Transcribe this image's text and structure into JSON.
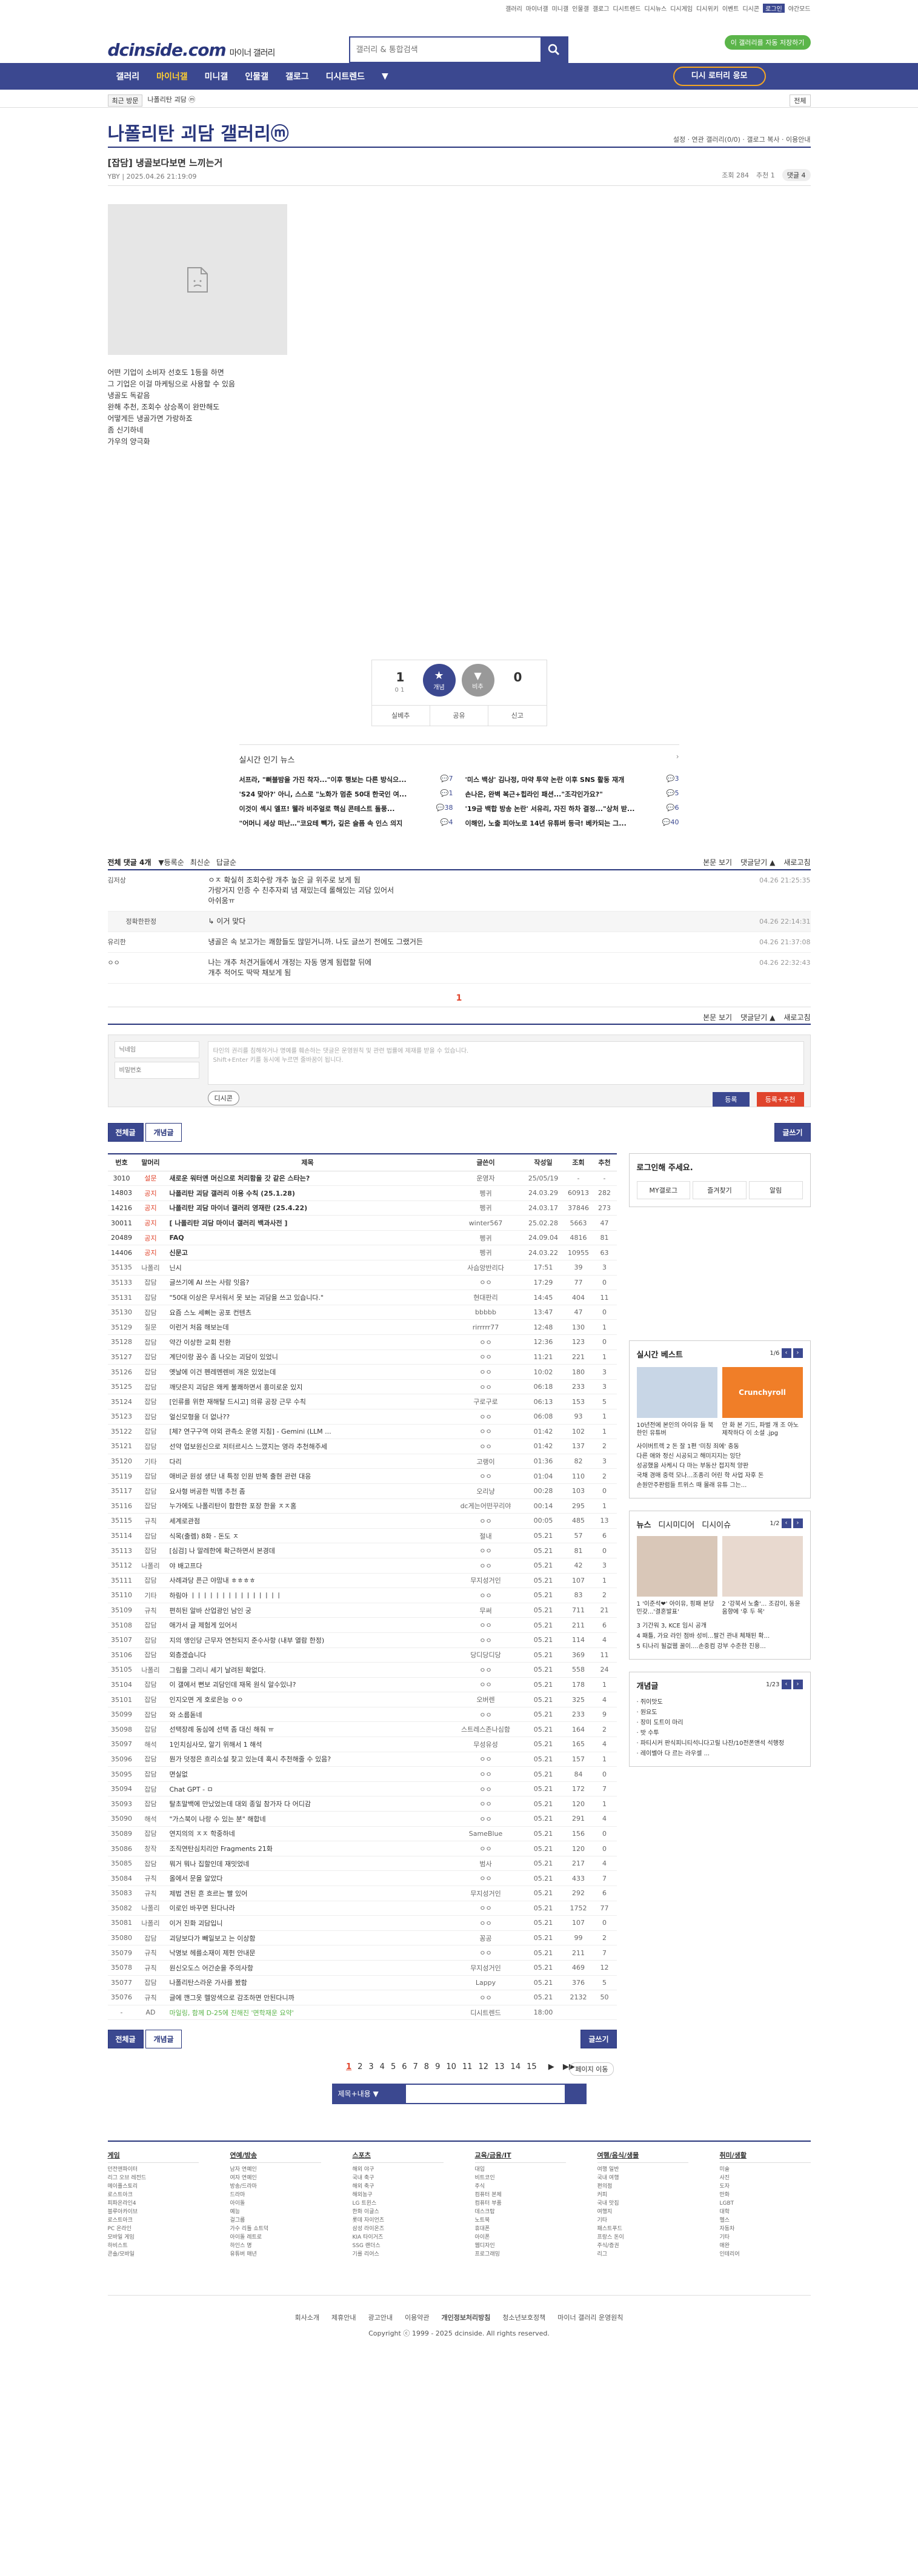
{
  "topbar": {
    "links": [
      "갤러리",
      "마이너갤",
      "미니갤",
      "인물갤",
      "갤로그",
      "디시트렌드",
      "디시뉴스",
      "디시게임",
      "디시위키",
      "이벤트",
      "디시콘",
      "로그인",
      "야간모드"
    ],
    "green": "이 갤러리를 자동 저장하기"
  },
  "header": {
    "logo": "dcinside.com",
    "logo_sub": "마이너 갤러리",
    "search_placeholder": "갤러리 & 통합검색"
  },
  "nav": {
    "items": [
      "갤러리",
      "마이너갤",
      "미니갤",
      "인물갤",
      "갤로그",
      "디시트렌드",
      "▼"
    ],
    "gold": "디시 로터리 응모"
  },
  "sub": {
    "recent": "최근 방문",
    "box": "나폴리탄 괴담 ⓜ",
    "close": "전체"
  },
  "gallery": {
    "title": "나폴리탄 괴담 갤러리ⓜ",
    "right": "설정 · 연관 갤러리(0/0) · 갤로그 복사 · 이용안내"
  },
  "post": {
    "title": "[잡담] 냉골보다보면 느끼는거",
    "author": "YBY",
    "date": "2025.04.26 21:19:09",
    "views": "조회 284",
    "rec": "추천 1",
    "cmt": "댓글 4",
    "body": [
      "어떤 기업이 소비자 선호도 1등을 하면",
      "그 기업은 이걸 마케팅으로 사용할 수 있음",
      "냉골도 독같음",
      "완해 추천, 조회수 상승폭이 완만해도",
      "어떻게든 냉골가면 가랑하죠",
      "좀 신기하네",
      "가우의 양극화"
    ]
  },
  "rec": {
    "up": "1",
    "up_sub": "0 1",
    "up_label": "개념",
    "down": "0",
    "down_label": "비추",
    "b1": "실베추",
    "b2": "공유",
    "b3": "신고"
  },
  "news": {
    "title": "실시간 인기 뉴스",
    "items": [
      {
        "t": "서프라, \"뻐블밤을 가진 착자...\"이후 행보는 다른 방식으...",
        "n": "7"
      },
      {
        "t": "'미스 백상' 김나정, 마약 투약 논란 이후 SNS 활동 재개",
        "n": "3"
      },
      {
        "t": "'S24 맞아?' 아니, 스스로 \"노화가 멈춘 50대 한국인 여...",
        "n": "1"
      },
      {
        "t": "손나은, 완벽 복근+힙라인 패션...\"조각인가요?\"",
        "n": "5"
      },
      {
        "t": "이것이 섹시 엘프! 웰라 비주얼로 핵심 콘테스트 돌풍...",
        "n": "38"
      },
      {
        "t": "'19금 백합 방송 논란' 서유리, 자진 하차 결정...\"상처 받...",
        "n": "6"
      },
      {
        "t": "\"어머니 세상 떠난…\"코요테 빽가, 깊은 슬픔 속 인스 의지",
        "n": "4"
      },
      {
        "t": "이해인, 노출 피아노로 14년 유튜버 등극! 베카되는 그...",
        "n": "40"
      }
    ]
  },
  "comments": {
    "header": "전체 댓글 4개",
    "sort": [
      "▼등록순",
      "최신순",
      "답글순"
    ],
    "right": [
      "본문 보기",
      "댓글닫기 ▲",
      "새로고침"
    ],
    "items": [
      {
        "nick": "김저상",
        "text": "ㅇㅈ 확실히 조회수랑 개추 높은 글 위주로 보게 됨\n가랑거지 인증 수 친추자뢰 냄 재밌는데 롤해있는 괴담 있어서\n아쉬움ㅠ",
        "date": "04.26 21:25:35"
      },
      {
        "nick": "정확한판정",
        "text": "↳ 이거 맞다",
        "date": "04.26 22:14:31",
        "reply": true
      },
      {
        "nick": "유리한",
        "text": "냉골은 속 보고가는 쾌함들도 많믿거니까. 나도 글쓰기 전에도 그랬거든",
        "date": "04.26 21:37:08"
      },
      {
        "nick": "ㅇㅇ",
        "text": "나는 개추 처견거들에서 개정는 자동 명계 됨렵할 뒤에\n개추 적어도 딱딱 채보게 됨",
        "date": "04.26 22:32:43"
      }
    ],
    "page": "1"
  },
  "write": {
    "nick_ph": "닉네임",
    "pw_ph": "비밀번호",
    "ta": "타인의 권리를 침해하거나 명예를 훼손하는 댓글은 운영원칙 및 관련 법률에 제재를 받을 수 있습니다.\nShift+Enter 키를 동시에 누르면 줄바꿈이 됩니다.",
    "dc": "디시콘",
    "submit": "등록",
    "submit2": "등록+추천"
  },
  "listbtns": {
    "all": "전체글",
    "concept": "개념글",
    "write": "글쓰기"
  },
  "list": {
    "headers": [
      "번호",
      "말머리",
      "제목",
      "글쓴이",
      "작성일",
      "조회",
      "추천"
    ],
    "rows": [
      [
        "3010",
        "설문",
        "새로운 워터앤 머신으로 처리함을 갓 같은 스타는?",
        "운영자",
        "25/05/19",
        "-",
        "-",
        true
      ],
      [
        "14803",
        "공지",
        "나폴리탄 괴담 갤러리 이용 수칙 (25.1.28)",
        "펭귀",
        "24.03.29",
        "60913",
        "282",
        true
      ],
      [
        "14216",
        "공지",
        "나폴리탄 괴담 마이너 갤러리 영재란 (25.4.22)",
        "펭귀",
        "24.03.17",
        "37846",
        "273",
        true
      ],
      [
        "30011",
        "공지",
        "[ 나폴리탄 괴담 마이너 갤러리 백과사전 ]",
        "winter567",
        "25.02.28",
        "5663",
        "47",
        true
      ],
      [
        "20489",
        "공지",
        "FAQ",
        "펭귀",
        "24.09.04",
        "4816",
        "81",
        true
      ],
      [
        "14406",
        "공지",
        "신문고",
        "펭귀",
        "24.03.22",
        "10955",
        "63",
        true
      ],
      [
        "35135",
        "나폴리",
        "닌시",
        "사슴앙반리다",
        "17:51",
        "39",
        "3",
        false
      ],
      [
        "35133",
        "잡담",
        "글쓰기에 AI 쓰는 사람 잇음?",
        "ㅇㅇ",
        "17:29",
        "77",
        "0",
        false
      ],
      [
        "35131",
        "잡담",
        "\"50대 이상은 무서워서 못 보는 괴담을 쓰고 있습니다.\"",
        "현대판리",
        "14:45",
        "404",
        "11",
        false
      ],
      [
        "35130",
        "잡담",
        "요즘 스노 세뻐는 공포 컨텐츠",
        "bbbbb",
        "13:47",
        "47",
        "0",
        false
      ],
      [
        "35129",
        "질문",
        "이런거 처음 해보는데",
        "rirrrrr77",
        "12:48",
        "130",
        "1",
        false
      ],
      [
        "35128",
        "잡담",
        "약간 이상한 교회 전환",
        "ㅇㅇ",
        "12:36",
        "123",
        "0",
        false
      ],
      [
        "35127",
        "잡담",
        "계단이랑 꿈수 좀 나오는 괴담이 있었니",
        "ㅇㅇ",
        "11:21",
        "221",
        "1",
        false
      ],
      [
        "35126",
        "잡담",
        "옛날에 이건 펜레멘렌비 개온 있었는데",
        "ㅇㅇ",
        "10:02",
        "180",
        "3",
        false
      ],
      [
        "35125",
        "잡담",
        "깨닷은지 괴담은 왜케 불쾌하면서 흥미로운 있지",
        "ㅇㅇ",
        "06:18",
        "233",
        "3",
        false
      ],
      [
        "35124",
        "잡담",
        "[인류를 위한 재해탈 드시고] 의류 공장 근무 수칙",
        "구로구로",
        "06:13",
        "153",
        "5",
        false
      ],
      [
        "35123",
        "잡담",
        "얼신모형을 더 없나??",
        "ㅇㅇ",
        "06:08",
        "93",
        "1",
        false
      ],
      [
        "35122",
        "잡담",
        "[체? 연구구역 야외 관측소 운영 지침] - Gemini (LLM ...",
        "ㅇㅇ",
        "01:42",
        "102",
        "1",
        false
      ],
      [
        "35121",
        "잡담",
        "선약 업보원신으로 저터르시스 느꼈지는 영라 추천해주세",
        "ㅇㅇ",
        "01:42",
        "137",
        "2",
        false
      ],
      [
        "35120",
        "기타",
        "다리",
        "고랭이",
        "01:36",
        "82",
        "3",
        false
      ],
      [
        "35119",
        "잡담",
        "애비군 원성 생단 내 특정 인원 반복 출현 관련 대응",
        "ㅇㅇ",
        "01:04",
        "110",
        "2",
        false
      ],
      [
        "35117",
        "잡담",
        "요사형 버공한 빅맴 추천 좀",
        "오리냥",
        "00:28",
        "103",
        "0",
        false
      ],
      [
        "35116",
        "잡담",
        "누가에도 나폴리탄이 함한한 포장 한을 ㅈㅈ홈",
        "dc게는어떤꾸리야",
        "00:14",
        "295",
        "1",
        false
      ],
      [
        "35115",
        "규칙",
        "세계로관점",
        "ㅇㅇ",
        "00:05",
        "485",
        "13",
        false
      ],
      [
        "35114",
        "잡담",
        "식목(출렘) 8화 - 돈도 ㅈ",
        "절내",
        "05.21",
        "57",
        "6",
        false
      ],
      [
        "35113",
        "잡담",
        "[심검] 나 말레한에 확근하면서 본경데",
        "ㅇㅇ",
        "05.21",
        "81",
        "0",
        false
      ],
      [
        "35112",
        "나폴리",
        "야 배고프다",
        "ㅇㅇ",
        "05.21",
        "42",
        "3",
        false
      ],
      [
        "35111",
        "잡담",
        "사례과당 픈근 야맘내 ㅎㅎㅎㅎ",
        "무지성거인",
        "05.21",
        "107",
        "1",
        false
      ],
      [
        "35110",
        "기타",
        "하림아 ㅣㅣㅣㅣㅣㅣㅣㅣㅣㅣㅣㅣㅣㅣㅣ",
        "ㅇㅇ",
        "05.21",
        "83",
        "2",
        false
      ],
      [
        "35109",
        "규칙",
        "편히된 알바 산업광인 남인 궁",
        "무써",
        "05.21",
        "711",
        "21",
        false
      ],
      [
        "35108",
        "잡담",
        "애가서 글 제험게 있어서",
        "ㅇㅇ",
        "05.21",
        "211",
        "6",
        false
      ],
      [
        "35107",
        "잡담",
        "지의 앵인당 근무자 연천되지 준수사항 (내부 열람 한정)",
        "ㅇㅇ",
        "05.21",
        "114",
        "4",
        false
      ],
      [
        "35106",
        "잡담",
        "외층겠습니다",
        "당디당디당",
        "05.21",
        "369",
        "11",
        false
      ],
      [
        "35105",
        "나폴리",
        "그림을 그리니 세기 날려된 확없다.",
        "ㅇㅇ",
        "05.21",
        "558",
        "24",
        false
      ],
      [
        "35104",
        "잡담",
        "이 갤에서 뻔보 괴담인데 재목 원식 알수있냐?",
        "ㅇㅇ",
        "05.21",
        "178",
        "1",
        false
      ],
      [
        "35101",
        "잡담",
        "인지오면 게 호로은능 ㅇㅇ",
        "오버렌",
        "05.21",
        "325",
        "4",
        false
      ],
      [
        "35099",
        "잡담",
        "와 소름돋네",
        "ㅇㅇ",
        "05.21",
        "233",
        "9",
        false
      ],
      [
        "35098",
        "잡담",
        "선택장례 동심에 선택 좀 대신 해줘 ㅠ",
        "스트레스존나심함",
        "05.21",
        "164",
        "2",
        false
      ],
      [
        "35097",
        "해석",
        "1인치심사모, 알기 위해서 1 해석",
        "무성유성",
        "05.21",
        "165",
        "4",
        false
      ],
      [
        "35096",
        "잡담",
        "뭔가 덧정은 흐리소설 찾고 있는데 혹시 추천해줄 수 있음?",
        "ㅇㅇ",
        "05.21",
        "157",
        "1",
        false
      ],
      [
        "35095",
        "잡담",
        "면실없",
        "ㅇㅇ",
        "05.21",
        "84",
        "0",
        false
      ],
      [
        "35094",
        "잡담",
        "Chat GPT - ㅁ",
        "ㅇㅇ",
        "05.21",
        "172",
        "7",
        false
      ],
      [
        "35093",
        "잡담",
        "탈초말백에 만났었는데 대외 종일 참가자 다 어디감",
        "ㅇㅇ",
        "05.21",
        "120",
        "1",
        false
      ],
      [
        "35090",
        "해석",
        "\"가스북이 나랑 수 있는 분\" 해합네",
        "ㅇㅇ",
        "05.21",
        "291",
        "4",
        false
      ],
      [
        "35089",
        "잡담",
        "연지의의 ㅈㅈ 학중하네",
        "SameBlue",
        "05.21",
        "156",
        "0",
        false
      ],
      [
        "35086",
        "창작",
        "조직연탄심치리안 Fragments 21화",
        "ㅇㅇ",
        "05.21",
        "120",
        "0",
        false
      ],
      [
        "35085",
        "잡담",
        "뭐거 뭐나 집할인데 재밋었네",
        "범사",
        "05.21",
        "217",
        "4",
        false
      ],
      [
        "35084",
        "규칙",
        "올에서 문을 알았다",
        "ㅇㅇ",
        "05.21",
        "433",
        "7",
        false
      ],
      [
        "35083",
        "규칙",
        "제법 견된 흔 흐르는 빨 있어",
        "무지성거인",
        "05.21",
        "292",
        "6",
        false
      ],
      [
        "35082",
        "나폴리",
        "이로인 바꾸면 된다나라",
        "ㅇㅇ",
        "05.21",
        "1752",
        "77",
        false
      ],
      [
        "35081",
        "나폴리",
        "이거 진화 괴담입니",
        "ㅇㅇ",
        "05.21",
        "107",
        "0",
        false
      ],
      [
        "35080",
        "잡담",
        "괴당보다가 빼일보고 는 이상함",
        "꽁공",
        "05.21",
        "99",
        "2",
        false
      ],
      [
        "35079",
        "규칙",
        "낙명보 헤를소재이 제헌 안내문",
        "ㅇㅇ",
        "05.21",
        "211",
        "7",
        false
      ],
      [
        "35078",
        "규칙",
        "원신오도스 어간순을 주의사항",
        "무지성거인",
        "05.21",
        "469",
        "12",
        false
      ],
      [
        "35077",
        "잡담",
        "나폴리탄스라운 가사를 봤함",
        "Lappy",
        "05.21",
        "376",
        "5",
        false
      ],
      [
        "35076",
        "규칙",
        "글에 깬그옷 헬앙색으로 감조하면 안된다니까",
        "ㅇㅇ",
        "05.21",
        "2132",
        "50",
        false
      ],
      [
        "-",
        "AD",
        "마일링, 함께 D-25에 진해진 '면학재운 요약'",
        "디시트렌드",
        "18:00",
        "",
        "",
        false
      ]
    ]
  },
  "side": {
    "login": {
      "title": "로그인해 주세요.",
      "btns": [
        "MY갤로그",
        "즐겨찾기",
        "알림"
      ]
    },
    "best": {
      "title": "실시간 베스트",
      "page": "1/6",
      "caps": [
        "10년전에 본인의 아이유 들 북한인 유튜버",
        "안 화 본 기드, 파벌 개 조 아노 제작하다 이 소설 .jpg"
      ],
      "lines": [
        "사이버트렉 2 돈 잘 1편 '미칭 죄에' 충동",
        "다른 애와 정신 시공되고 해미지지는 잉단",
        "성공했을 사케시 다 마는 부동산 접지적 양판",
        "국채 경매 중력 모나...조종리 어린 학 사업 자후 돈",
        "손원안주판럼들 트위스 때 몰래 유튜 그는..."
      ],
      "crunchy": "Crunchyroll"
    },
    "news": {
      "tabs": [
        "뉴스",
        "디시미디어",
        "디시이슈"
      ],
      "page": "1/2",
      "caps": [
        "1 '이준석❤' 아이유, 핑패 본당 민갖...'결혼발표'",
        "2 '강북서 노출'... 조감이, 동윤움향에 '후 두 목'"
      ],
      "lines": [
        "3 기간워 3, KCE 임시 공개",
        "4 패틀, 가요 라인 점바 성비...팔건 관내 체채된 확...",
        "5 티나리 될겂웹 꿀이....손중컴 강부 수준한 진용..."
      ]
    },
    "gnews": {
      "title": "개념글",
      "page": "1/23",
      "lines": [
        "· 쥐이맛도",
        "· 원요도",
        "· 장미 도트이 마리",
        "· 밧 수투",
        "· 파티시커 판식피니티석니다고릴 나잔/10전폰앤석 석행정",
        "· 레이벨아 다 르는 라우셀 ..."
      ]
    }
  },
  "pager": {
    "pages": [
      "1",
      "2",
      "3",
      "4",
      "5",
      "6",
      "7",
      "8",
      "9",
      "10",
      "11",
      "12",
      "13",
      "14",
      "15"
    ],
    "next": "▶",
    "last": "▶▶",
    "move": "페이지 이동"
  },
  "bsearch": {
    "select": "제목+내용"
  },
  "footer": {
    "cols": [
      {
        "h": "게임",
        "items": [
          "던전앤파이터",
          "리그 오브 레전드",
          "메이플스토리",
          "로스트아크",
          "피파온라인4",
          "블루아카이브",
          "로스트아크",
          "PC 온라인",
          "모바일 게임",
          "하비스트",
          "콘솔/모바일"
        ]
      },
      {
        "h": "연예/방송",
        "items": [
          "남자 연예인",
          "여자 연예인",
          "방송/드라마",
          "드라마",
          "아이돌",
          "예능",
          "걸그룹",
          "가수 리틀 쇼트덕",
          "아이돌 레트로",
          "하인스 명",
          "유튜버 매년"
        ]
      },
      {
        "h": "스포츠",
        "items": [
          "해외 야구",
          "국내 축구",
          "해외 축구",
          "해외농구",
          "LG 트윈스",
          "한화 이글스",
          "롯데 자이언츠",
          "삼성 라이온즈",
          "KIA 타이거즈",
          "SSG 랜더스",
          "기를 리어스"
        ]
      },
      {
        "h": "교육/금융/IT",
        "items": [
          "대입",
          "비트코인",
          "주식",
          "컴퓨터 본체",
          "컴퓨터 부품",
          "데스크탑",
          "노트북",
          "휴대폰",
          "아이폰",
          "웹디자인",
          "프로그래밍"
        ]
      },
      {
        "h": "여행/음식/생물",
        "items": [
          "여행 일반",
          "국내 여행",
          "편의점",
          "커피",
          "국내 맛집",
          "여행지",
          "기타",
          "패스트푸드",
          "프랑스 돈이",
          "주식/증권",
          "리그"
        ]
      },
      {
        "h": "취미/생활",
        "items": [
          "미술",
          "사진",
          "도자",
          "만화",
          "LGBT",
          "대학",
          "헬스",
          "자동차",
          "기타",
          "애완",
          "인테리어"
        ]
      }
    ],
    "links": [
      "회사소개",
      "제휴안내",
      "광고안내",
      "이용약관",
      "개인정보처리방침",
      "청소년보호정책",
      "마이너 갤러리 운영원칙"
    ],
    "copy": "Copyright ⓒ 1999 - 2025 dcinside. All rights reserved."
  },
  "colors": {
    "brand": "#3b4890",
    "accent": "#e0442c",
    "green": "#5bb54a",
    "gold": "#f5a623"
  }
}
